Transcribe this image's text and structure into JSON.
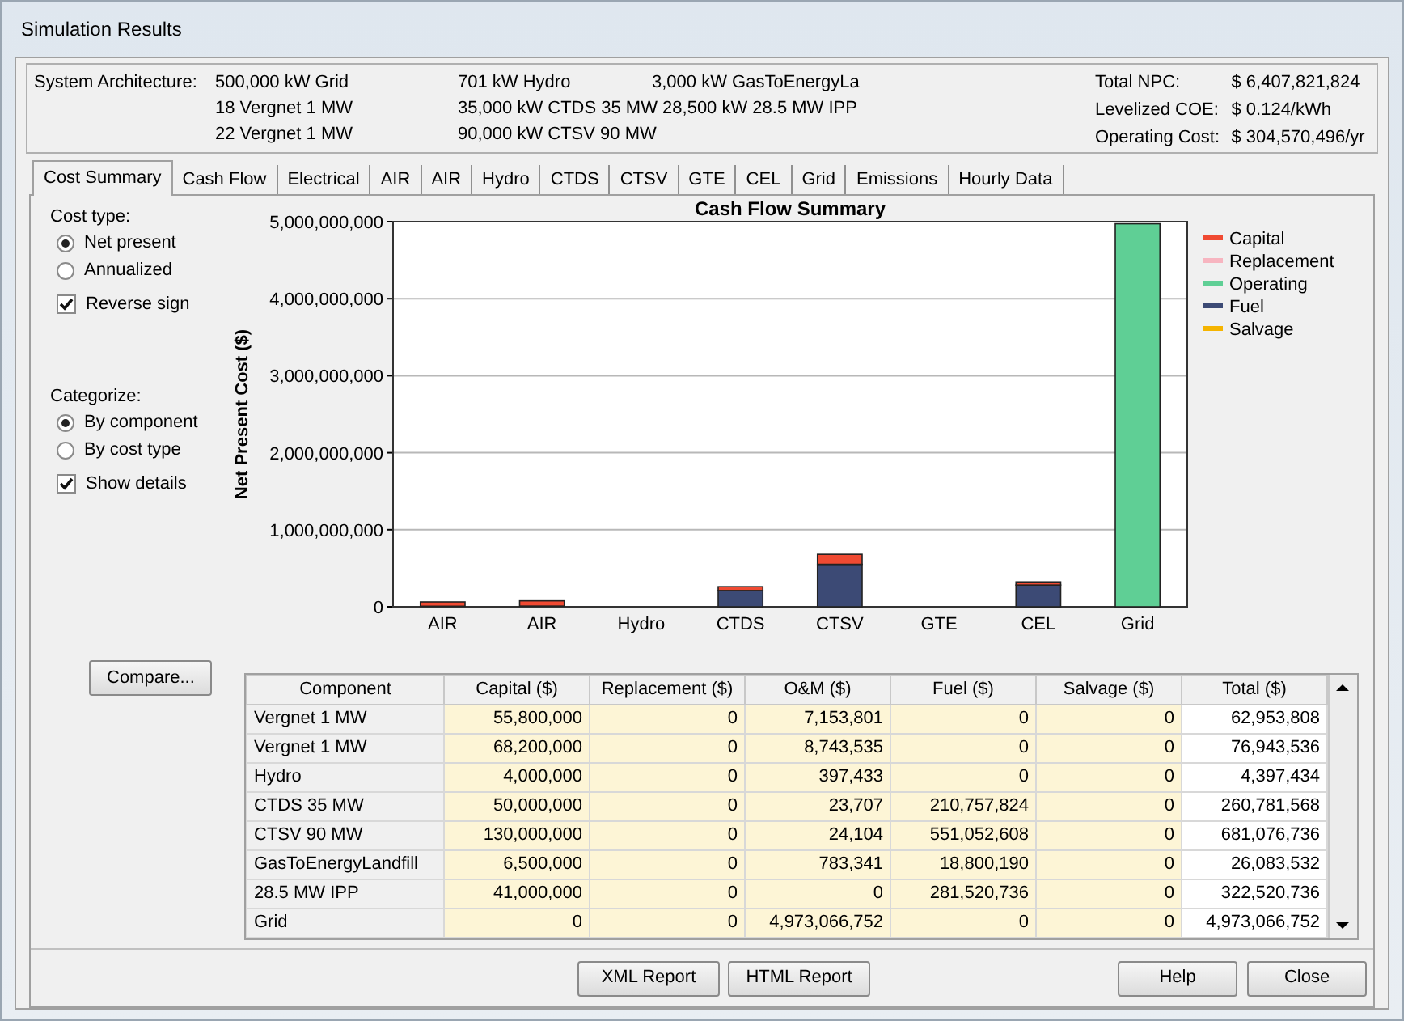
{
  "window": {
    "title": "Simulation Results"
  },
  "architecture": {
    "label": "System Architecture:",
    "columns": [
      [
        "500,000 kW Grid",
        "18 Vergnet 1 MW",
        "22 Vergnet 1 MW"
      ],
      [
        "701 kW Hydro",
        "35,000 kW CTDS 35 MW 28,500 kW 28.5 MW IPP",
        "90,000 kW CTSV 90 MW"
      ],
      [
        "3,000 kW GasToEnergyLa"
      ]
    ]
  },
  "totals": [
    {
      "label": "Total NPC:",
      "value": "$ 6,407,821,824"
    },
    {
      "label": "Levelized COE:",
      "value": "$ 0.124/kWh"
    },
    {
      "label": "Operating Cost:",
      "value": "$ 304,570,496/yr"
    }
  ],
  "tabs": [
    {
      "label": "Cost Summary",
      "selected": true
    },
    {
      "label": "Cash Flow",
      "selected": false
    },
    {
      "label": "Electrical",
      "selected": false
    },
    {
      "label": "AIR",
      "selected": false
    },
    {
      "label": "AIR",
      "selected": false
    },
    {
      "label": "Hydro",
      "selected": false
    },
    {
      "label": "CTDS",
      "selected": false
    },
    {
      "label": "CTSV",
      "selected": false
    },
    {
      "label": "GTE",
      "selected": false
    },
    {
      "label": "CEL",
      "selected": false
    },
    {
      "label": "Grid",
      "selected": false
    },
    {
      "label": "Emissions",
      "selected": false
    },
    {
      "label": "Hourly Data",
      "selected": false
    }
  ],
  "options": [
    {
      "kind": "heading",
      "label": "Cost type:"
    },
    {
      "kind": "radio",
      "label": "Net present",
      "selected": true
    },
    {
      "kind": "radio",
      "label": "Annualized",
      "selected": false
    },
    {
      "kind": "checkbox",
      "label": "Reverse sign",
      "checked": true
    },
    {
      "kind": "spacer"
    },
    {
      "kind": "heading",
      "label": "Categorize:"
    },
    {
      "kind": "radio",
      "label": "By component",
      "selected": true
    },
    {
      "kind": "radio",
      "label": "By cost type",
      "selected": false
    },
    {
      "kind": "checkbox",
      "label": "Show details",
      "checked": true
    }
  ],
  "compare_button": "Compare...",
  "chart_data": {
    "type": "bar",
    "stacked": true,
    "grid": true,
    "legend": true,
    "title": "Cash Flow Summary",
    "ylabel": "Net Present Cost ($)",
    "categories": [
      "AIR",
      "AIR",
      "Hydro",
      "CTDS",
      "CTSV",
      "GTE",
      "CEL",
      "Grid"
    ],
    "series": [
      {
        "name": "Capital",
        "color": "#f04a32",
        "values": [
          56000000,
          68000000,
          4000000,
          50000000,
          130000000,
          7000000,
          41000000,
          0
        ]
      },
      {
        "name": "Replacement",
        "color": "#f7b5c0",
        "values": [
          0,
          0,
          0,
          0,
          0,
          0,
          0,
          0
        ]
      },
      {
        "name": "Operating",
        "color": "#5fcf95",
        "values": [
          7000000,
          9000000,
          0,
          0,
          0,
          1000000,
          0,
          4973000000
        ]
      },
      {
        "name": "Fuel",
        "color": "#3c4a75",
        "values": [
          0,
          0,
          0,
          211000000,
          551000000,
          19000000,
          282000000,
          0
        ]
      },
      {
        "name": "Salvage",
        "color": "#f5b400",
        "values": [
          0,
          0,
          0,
          0,
          0,
          0,
          0,
          0
        ]
      }
    ],
    "ylim": [
      0,
      5000000000
    ],
    "yticks": [
      {
        "value": 0,
        "label": "0"
      },
      {
        "value": 1000000000,
        "label": "1,000,000,000"
      },
      {
        "value": 2000000000,
        "label": "2,000,000,000"
      },
      {
        "value": 3000000000,
        "label": "3,000,000,000"
      },
      {
        "value": 4000000000,
        "label": "4,000,000,000"
      },
      {
        "value": 5000000000,
        "label": "5,000,000,000"
      }
    ]
  },
  "table": {
    "columns": [
      "Component",
      "Capital ($)",
      "Replacement ($)",
      "O&M ($)",
      "Fuel ($)",
      "Salvage ($)",
      "Total ($)"
    ],
    "rows": [
      [
        "Vergnet 1 MW",
        "55,800,000",
        "0",
        "7,153,801",
        "0",
        "0",
        "62,953,808"
      ],
      [
        "Vergnet 1 MW",
        "68,200,000",
        "0",
        "8,743,535",
        "0",
        "0",
        "76,943,536"
      ],
      [
        "Hydro",
        "4,000,000",
        "0",
        "397,433",
        "0",
        "0",
        "4,397,434"
      ],
      [
        "CTDS 35 MW",
        "50,000,000",
        "0",
        "23,707",
        "210,757,824",
        "0",
        "260,781,568"
      ],
      [
        "CTSV 90 MW",
        "130,000,000",
        "0",
        "24,104",
        "551,052,608",
        "0",
        "681,076,736"
      ],
      [
        "GasToEnergyLandfill",
        "6,500,000",
        "0",
        "783,341",
        "18,800,190",
        "0",
        "26,083,532"
      ],
      [
        "28.5 MW IPP",
        "41,000,000",
        "0",
        "0",
        "281,520,736",
        "0",
        "322,520,736"
      ],
      [
        "Grid",
        "0",
        "0",
        "4,973,066,752",
        "0",
        "0",
        "4,973,066,752"
      ]
    ]
  },
  "footer_buttons": [
    "XML Report",
    "HTML Report"
  ],
  "dialog_buttons": [
    "Help",
    "Close"
  ]
}
